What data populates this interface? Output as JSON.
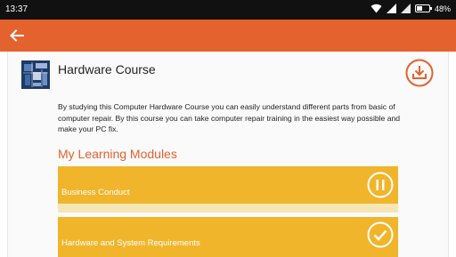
{
  "status_bar": {
    "time": "13:37",
    "battery_percent": "48%",
    "battery_level": 0.48,
    "icons": [
      "wifi-icon",
      "signal-icon",
      "signal-icon",
      "battery-icon"
    ]
  },
  "app_bar": {
    "back_icon": "arrow-left-icon",
    "color": "#e4622d"
  },
  "course": {
    "title": "Hardware Course",
    "image": "circuit-board-thumbnail",
    "download_icon": "download-icon",
    "description": "By studying this Computer Hardware Course you can easily understand different parts from basic of computer repair. By this course you can take computer repair training in the easiest way possible and make your PC fix."
  },
  "modules_section": {
    "title": "My Learning Modules",
    "items": [
      {
        "label": "Business Conduct",
        "icon": "pause-icon"
      },
      {
        "label": "Hardware and System Requirements",
        "icon": "check-icon"
      }
    ]
  },
  "colors": {
    "accent": "#e4622d",
    "module": "#f1b52b",
    "module_strip": "#f7e6b5"
  }
}
